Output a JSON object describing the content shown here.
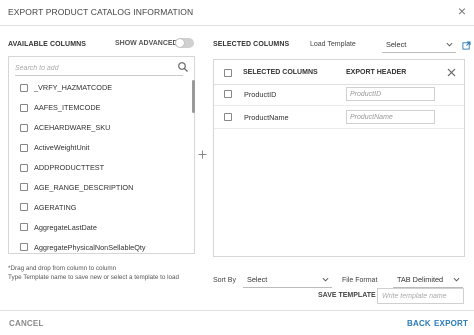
{
  "dialog": {
    "title": "EXPORT PRODUCT CATALOG INFORMATION",
    "close_glyph": "×"
  },
  "available": {
    "heading": "AVAILABLE COLUMNS",
    "show_advanced_label": "SHOW ADVANCED",
    "show_advanced_on": false,
    "search_placeholder": "Search to add",
    "items": [
      "_VRFY_HAZMATCODE",
      "AAFES_ITEMCODE",
      "ACEHARDWARE_SKU",
      "ActiveWeightUnit",
      "ADDPRODUCTTEST",
      "AGE_RANGE_DESCRIPTION",
      "AGERATING",
      "AggregateLastDate",
      "AggregatePhysicalNonSellableQty"
    ]
  },
  "selected": {
    "heading": "SELECTED COLUMNS",
    "load_template_label": "Load Template",
    "load_template_value": "Select",
    "col_selected": "SELECTED COLUMNS",
    "col_export_header": "EXPORT HEADER",
    "rows": [
      {
        "name": "ProductID",
        "header_placeholder": "ProductID"
      },
      {
        "name": "ProductName",
        "header_placeholder": "ProductName"
      }
    ]
  },
  "hints": {
    "line1": "*Drag and drop from column to column",
    "line2": "Type Template name to save new or select a template to load"
  },
  "options": {
    "sort_by_label": "Sort By",
    "sort_by_value": "Select",
    "file_format_label": "File Format",
    "file_format_value": "TAB Delimited",
    "save_template_label": "SAVE TEMPLATE",
    "template_name_placeholder": "Write template name"
  },
  "footer": {
    "cancel_label": "CANCEL",
    "back_label": "BACK",
    "export_label": "EXPORT"
  },
  "colors": {
    "accent": "#2a7ab8",
    "muted": "#888888"
  }
}
